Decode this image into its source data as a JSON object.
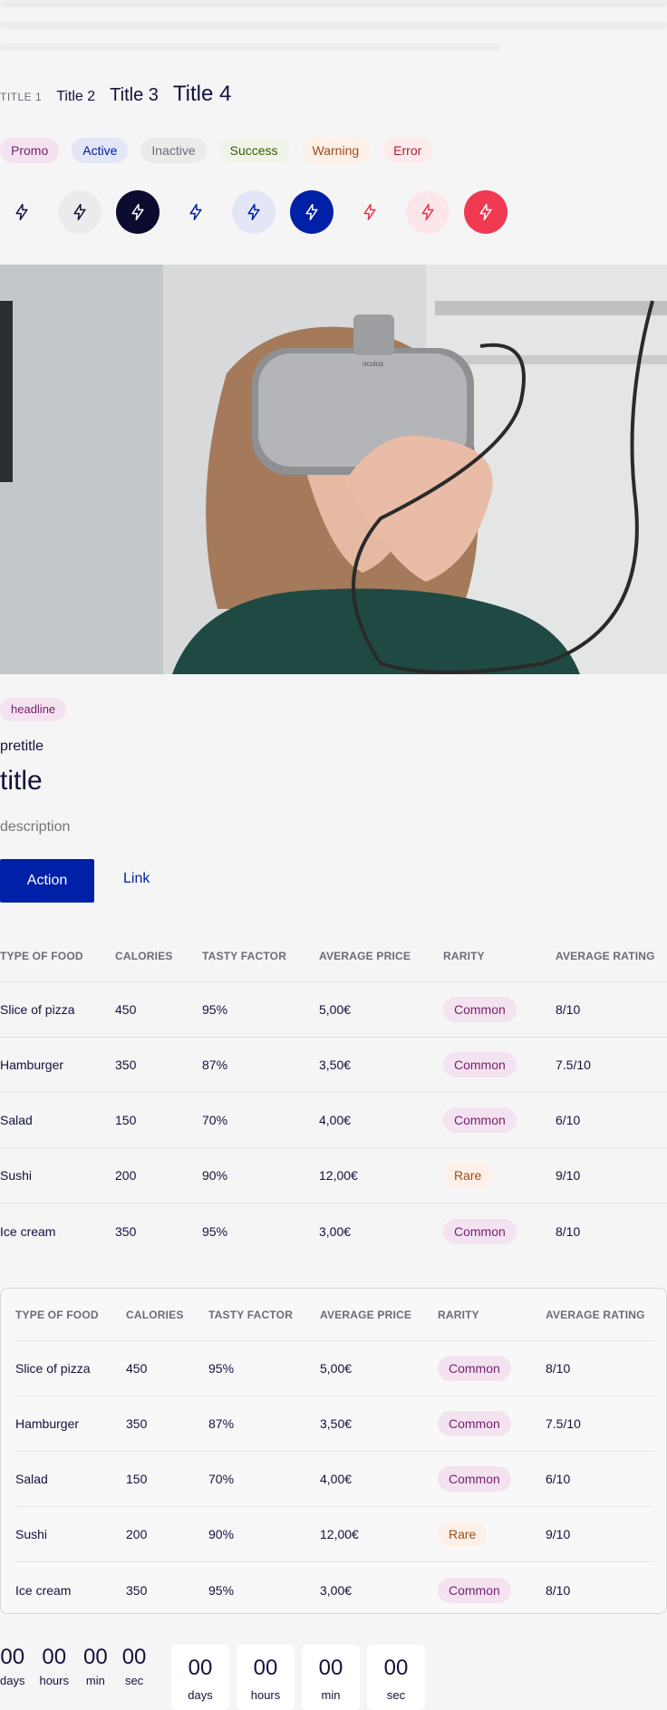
{
  "titles": {
    "t1": "TITLE 1",
    "t2": "Title 2",
    "t3": "Title 3",
    "t4": "Title 4"
  },
  "chips": [
    {
      "label": "Promo",
      "bg": "#f3e3f0",
      "fg": "#7a1e6e"
    },
    {
      "label": "Active",
      "bg": "#e2e6f7",
      "fg": "#0020a8"
    },
    {
      "label": "Inactive",
      "bg": "#ebebeb",
      "fg": "#6b6b7a"
    },
    {
      "label": "Success",
      "bg": "#f0f4e8",
      "fg": "#3a5a00"
    },
    {
      "label": "Warning",
      "bg": "#fdf0e8",
      "fg": "#a04a1a"
    },
    {
      "label": "Error",
      "bg": "#fdeaea",
      "fg": "#b0203a"
    }
  ],
  "icon_buttons": [
    {
      "icon": "lightning-icon",
      "bg": "transparent",
      "fg": "#12123d"
    },
    {
      "icon": "lightning-icon",
      "bg": "#ebebeb",
      "fg": "#12123d"
    },
    {
      "icon": "lightning-icon",
      "bg": "#0c0c30",
      "fg": "#ffffff"
    },
    {
      "icon": "lightning-icon",
      "bg": "transparent",
      "fg": "#0020a8"
    },
    {
      "icon": "lightning-icon",
      "bg": "#e2e6f7",
      "fg": "#0020a8"
    },
    {
      "icon": "lightning-icon",
      "bg": "#0020a8",
      "fg": "#ffffff"
    },
    {
      "icon": "lightning-icon",
      "bg": "transparent",
      "fg": "#e8354f"
    },
    {
      "icon": "lightning-icon",
      "bg": "#fde6ea",
      "fg": "#e8354f"
    },
    {
      "icon": "lightning-icon",
      "bg": "#f03a52",
      "fg": "#ffffff"
    }
  ],
  "card": {
    "headline": "headline",
    "pretitle": "pretitle",
    "title": "title",
    "description": "description",
    "action_label": "Action",
    "link_label": "Link"
  },
  "table": {
    "headers": [
      "TYPE OF FOOD",
      "CALORIES",
      "TASTY FACTOR",
      "AVERAGE PRICE",
      "RARITY",
      "AVERAGE RATING"
    ],
    "rows": [
      [
        "Slice of pizza",
        "450",
        "95%",
        "5,00€",
        "Common",
        "8/10"
      ],
      [
        "Hamburger",
        "350",
        "87%",
        "3,50€",
        "Common",
        "7.5/10"
      ],
      [
        "Salad",
        "150",
        "70%",
        "4,00€",
        "Common",
        "6/10"
      ],
      [
        "Sushi",
        "200",
        "90%",
        "12,00€",
        "Rare",
        "9/10"
      ],
      [
        "Ice cream",
        "350",
        "95%",
        "3,00€",
        "Common",
        "8/10"
      ]
    ]
  },
  "rarity_colors": {
    "Common": {
      "bg": "#f3e3f0",
      "fg": "#7a1e6e"
    },
    "Rare": {
      "bg": "#fdf0e8",
      "fg": "#a04a1a"
    }
  },
  "countdown": [
    {
      "value": "00",
      "unit": "days"
    },
    {
      "value": "00",
      "unit": "hours"
    },
    {
      "value": "00",
      "unit": "min"
    },
    {
      "value": "00",
      "unit": "sec"
    }
  ]
}
